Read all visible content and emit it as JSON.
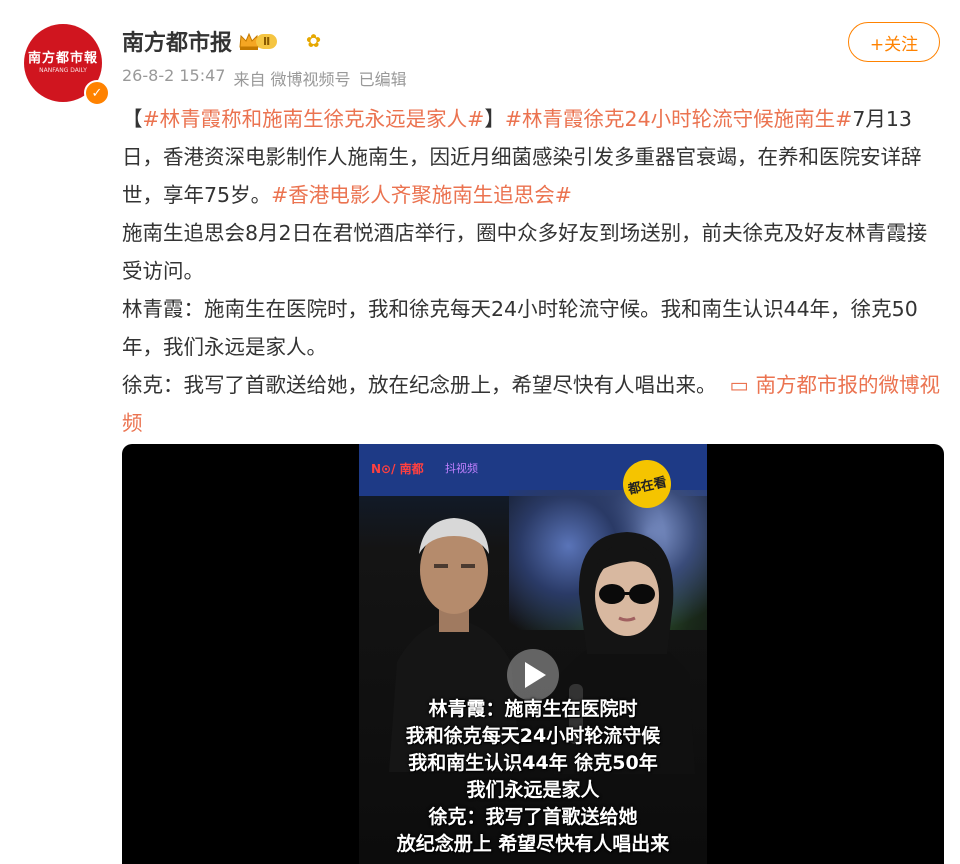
{
  "account": {
    "name": "南方都市报",
    "rank_badge": "Ⅱ",
    "avatar_text": "南方都市報",
    "avatar_sub": "NANFANG DAILY",
    "verified_mark": "✓",
    "timestamp": "26-8-2 15:47",
    "source": "来自 微博视频号",
    "edited": "已编辑",
    "follow_label": "+关注"
  },
  "post": {
    "p1": {
      "open_bracket": "【",
      "tag1": "#林青霞称和施南生徐克永远是家人#",
      "close_bracket": "】",
      "tag2": "#林青霞徐克24小时轮流守候施南生#",
      "text": "7月13日，香港资深电影制作人施南生，因近月细菌感染引发多重器官衰竭，在养和医院安详辞世，享年75岁。",
      "tag3": "#香港电影人齐聚施南生追思会#"
    },
    "p2": "施南生追思会8月2日在君悦酒店举行，圈中众多好友到场送别，前夫徐克及好友林青霞接受访问。",
    "p3": "林青霞：施南生在医院时，我和徐克每天24小时轮流守候。我和南生认识44年，徐克50年，我们永远是家人。",
    "p4": "徐克：我写了首歌送给她，放在纪念册上，希望尽快有人唱出来。",
    "video_link": "南方都市报的微博视频"
  },
  "video": {
    "brand": "N⊙/ 南都",
    "brand2": "抖视频",
    "badge": "都在看",
    "subtitles": [
      "林青霞：施南生在医院时",
      "我和徐克每天24小时轮流守候",
      "我和南生认识44年 徐克50年",
      "我们永远是家人",
      "徐克：我写了首歌送给她",
      "放纪念册上 希望尽快有人唱出来"
    ]
  },
  "colors": {
    "accent": "#ff8200",
    "link": "#eb7350",
    "avatar_bg": "#d0151f"
  }
}
